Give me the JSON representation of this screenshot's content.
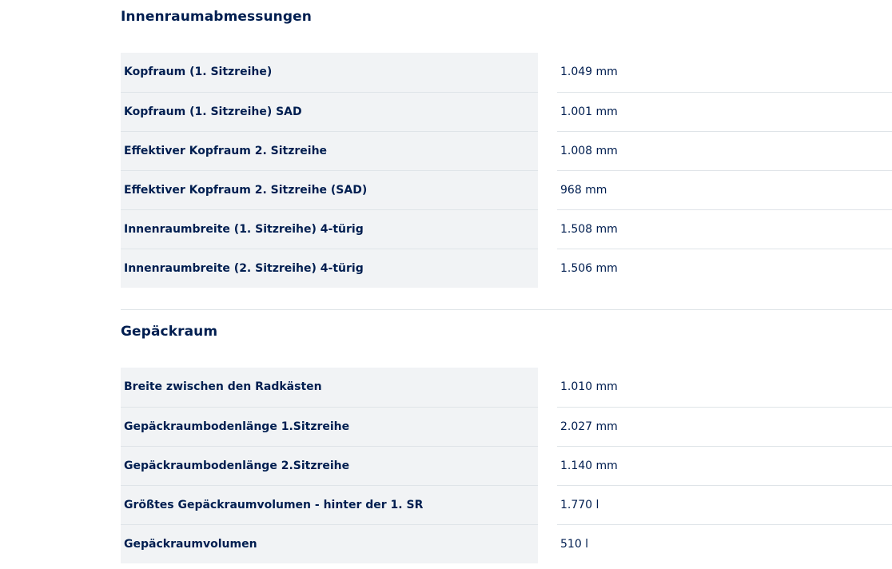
{
  "interior": {
    "title": "Innenraumabmessungen",
    "rows": [
      {
        "label": "Kopfraum (1. Sitzreihe)",
        "value": "1.049 mm"
      },
      {
        "label": "Kopfraum (1. Sitzreihe) SAD",
        "value": "1.001 mm"
      },
      {
        "label": "Effektiver Kopfraum 2. Sitzreihe",
        "value": "1.008 mm"
      },
      {
        "label": "Effektiver Kopfraum 2. Sitzreihe (SAD)",
        "value": "968 mm"
      },
      {
        "label": "Innenraumbreite (1. Sitzreihe) 4-türig",
        "value": "1.508 mm"
      },
      {
        "label": "Innenraumbreite (2. Sitzreihe) 4-türig",
        "value": "1.506 mm"
      }
    ]
  },
  "luggage": {
    "title": "Gepäckraum",
    "rows": [
      {
        "label": "Breite zwischen den Radkästen",
        "value": "1.010 mm"
      },
      {
        "label": "Gepäckraumbodenlänge 1.Sitzreihe",
        "value": "2.027 mm"
      },
      {
        "label": "Gepäckraumbodenlänge 2.Sitzreihe",
        "value": "1.140 mm"
      },
      {
        "label": "Größtes Gepäckraumvolumen - hinter der 1. SR",
        "value": "1.770 l"
      },
      {
        "label": "Gepäckraumvolumen",
        "value": "510 l"
      }
    ]
  }
}
